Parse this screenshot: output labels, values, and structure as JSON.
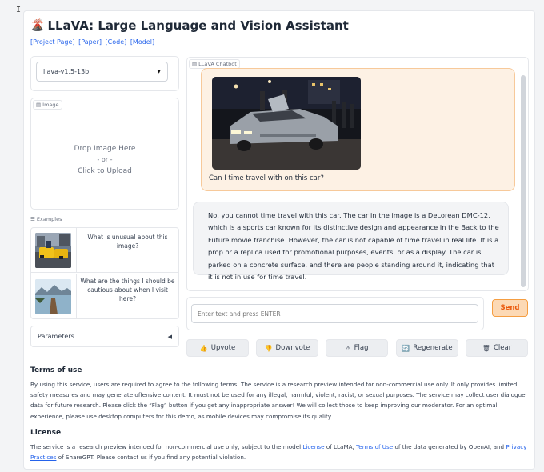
{
  "header": {
    "logo": "🌋",
    "title": "LLaVA: Large Language and Vision Assistant",
    "links": [
      "[Project Page]",
      "[Paper]",
      "[Code]",
      "[Model]"
    ]
  },
  "model_selector": {
    "value": "llava-v1.5-13b"
  },
  "image_upload": {
    "label": "Image",
    "line1": "Drop Image Here",
    "line2": "- or -",
    "line3": "Click to Upload"
  },
  "examples": {
    "label": "Examples",
    "items": [
      {
        "text": "What is unusual about this image?"
      },
      {
        "text": "What are the things I should be cautious about when I visit here?"
      }
    ]
  },
  "parameters": {
    "label": "Parameters",
    "caret": "◀"
  },
  "chat": {
    "label": "LLaVA Chatbot",
    "user_message": "Can I time travel with on this car?",
    "bot_message": "No, you cannot time travel with this car. The car in the image is a DeLorean DMC-12, which is a sports car known for its distinctive design and appearance in the Back to the Future movie franchise. However, the car is not capable of time travel in real life. It is a prop or a replica used for promotional purposes, events, or as a display. The car is parked on a concrete surface, and there are people standing around it, indicating that it is not in use for time travel."
  },
  "input": {
    "placeholder": "Enter text and press ENTER"
  },
  "buttons": {
    "send": "Send",
    "upvote": "Upvote",
    "downvote": "Downvote",
    "flag": "Flag",
    "regenerate": "Regenerate",
    "clear": "Clear"
  },
  "terms": {
    "title": "Terms of use",
    "text": "By using this service, users are required to agree to the following terms: The service is a research preview intended for non-commercial use only. It only provides limited safety measures and may generate offensive content. It must not be used for any illegal, harmful, violent, racist, or sexual purposes. The service may collect user dialogue data for future research. Please click the “Flag” button if you get any inappropriate answer! We will collect those to keep improving our moderator. For an optimal experience, please use desktop computers for this demo, as mobile devices may compromise its quality."
  },
  "license": {
    "title": "License",
    "text_1": "The service is a research preview intended for non-commercial use only, subject to the model ",
    "link_1": "License",
    "text_2": " of LLaMA, ",
    "link_2": "Terms of Use",
    "text_3": " of the data generated by OpenAI, and ",
    "link_3": "Privacy Practices",
    "text_4": " of ShareGPT. Please contact us if you find any potential violation."
  }
}
